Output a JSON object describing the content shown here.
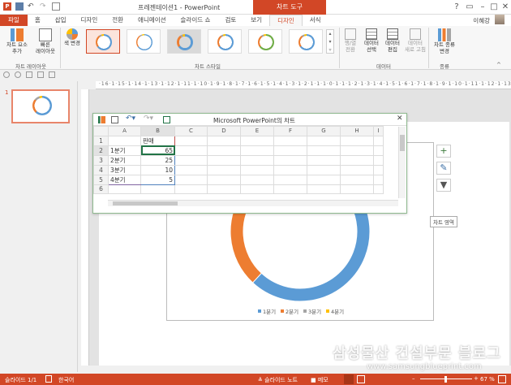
{
  "window": {
    "title": "프레젠테이션1 - PowerPoint",
    "tool_context": "차트 도구",
    "user": "이혜강"
  },
  "tabs": [
    "파일",
    "홈",
    "삽입",
    "디자인",
    "전환",
    "애니메이션",
    "슬라이드 쇼",
    "검토",
    "보기",
    "디자인",
    "서식"
  ],
  "ribbon": {
    "add_element": "차트 요소\n추가",
    "quick_layout": "빠른\n레이아웃",
    "layouts_group": "차트 레이아웃",
    "change_colors": "색 변경",
    "styles_group": "차트 스타일",
    "switch_row_col": "행/열\n전환",
    "select_data": "데이터\n선택",
    "edit_data": "데이터\n편집",
    "refresh_data": "데이터\n새로 고침",
    "data_group": "데이터",
    "change_type": "차트 종류\n변경",
    "type_group": "종류"
  },
  "ruler_text": "·16·1·15·1·14·1·13·1·12·1·11·1·10·1·9·1·8·1·7·1·6·1·5·1·4·1·3·1·2·1·1·1·0·1·1·1·2·1·3·1·4·1·5·1·6·1·7·1·8·1·9·1·10·1·11·1·12·1·13·1·14·1·15·1·16",
  "slide_number": "1",
  "datasheet": {
    "caption": "Microsoft PowerPoint의 차트",
    "columns": [
      "",
      "A",
      "B",
      "C",
      "D",
      "E",
      "F",
      "G",
      "H",
      "I"
    ],
    "rows": [
      {
        "n": "1",
        "a": "",
        "b": "판매"
      },
      {
        "n": "2",
        "a": "1분기",
        "b": "65"
      },
      {
        "n": "3",
        "a": "2분기",
        "b": "25"
      },
      {
        "n": "4",
        "a": "3분기",
        "b": "10"
      },
      {
        "n": "5",
        "a": "4분기",
        "b": "5"
      },
      {
        "n": "6",
        "a": "",
        "b": ""
      }
    ]
  },
  "chart_tooltip": "차트 영역",
  "legend": [
    "1분기",
    "2분기",
    "3분기",
    "4분기"
  ],
  "colors": {
    "accent": "#d24726",
    "q1": "#5b9bd5",
    "q2": "#ed7d31",
    "q3": "#a5a5a5",
    "q4": "#ffc000"
  },
  "status": {
    "slide": "슬라이드 1/1",
    "language": "한국어",
    "notes": "슬라이드 노트",
    "comments": "메모",
    "zoom": "67 %"
  },
  "watermark": {
    "text": "삼성물산 건설부문 블로그",
    "url": "www.samsungblueprint.com"
  },
  "chart_data": {
    "type": "pie",
    "categories": [
      "1분기",
      "2분기",
      "3분기",
      "4분기"
    ],
    "values": [
      65,
      25,
      10,
      5
    ],
    "series": [
      {
        "name": "판매",
        "values": [
          65,
          25,
          10,
          5
        ]
      }
    ],
    "legend_position": "bottom"
  }
}
